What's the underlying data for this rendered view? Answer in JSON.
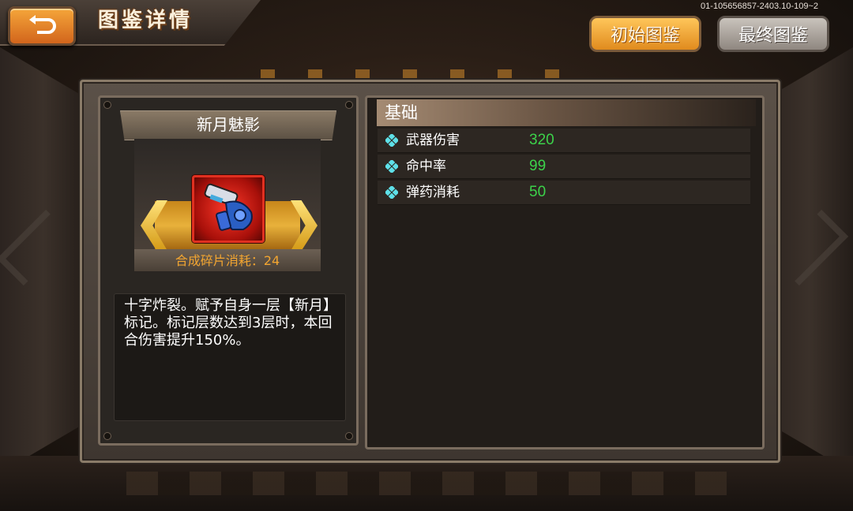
{
  "header": {
    "title": "图鉴详情",
    "debug_id": "01-105656857-2403.10-109~2"
  },
  "top_buttons": {
    "initial": "初始图鉴",
    "final": "最终图鉴"
  },
  "item": {
    "name": "新月魅影",
    "cost_label": "合成碎片消耗：24",
    "description": "十字炸裂。赋予自身一层【新月】标记。标记层数达到3层时，本回合伤害提升150%。"
  },
  "stats": {
    "section_title": "基础",
    "rows": [
      {
        "label": "武器伤害",
        "value": "320"
      },
      {
        "label": "命中率",
        "value": "99"
      },
      {
        "label": "弹药消耗",
        "value": "50"
      }
    ]
  },
  "colors": {
    "accent_orange": "#f2a531",
    "stat_green": "#3cd24a",
    "icon_frame_red": "#e03020"
  }
}
